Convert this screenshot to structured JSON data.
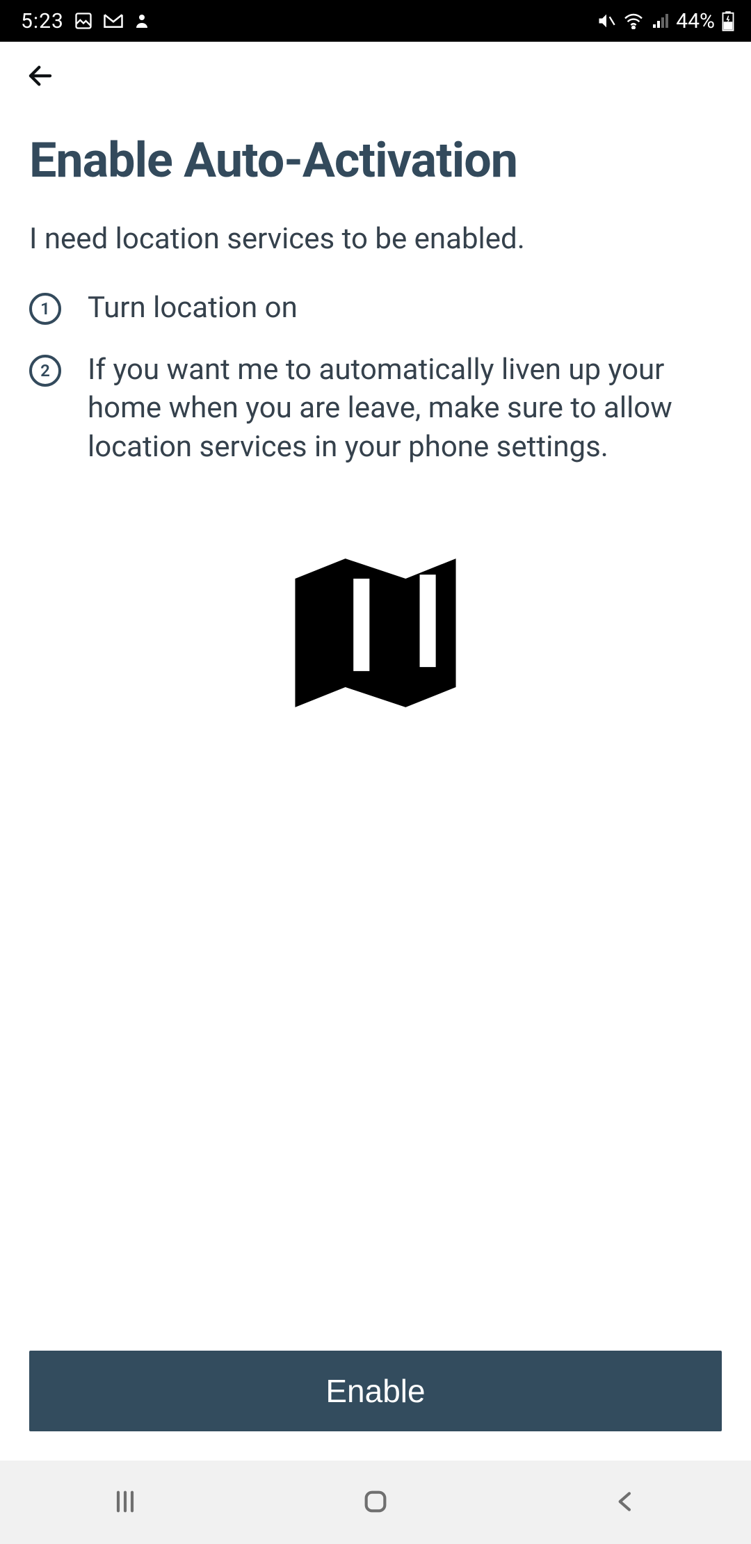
{
  "status": {
    "time": "5:23",
    "battery_pct": "44%",
    "icons_left": [
      "picture-icon",
      "gmail-icon",
      "person-icon"
    ],
    "icons_right": [
      "mute-icon",
      "wifi-icon",
      "signal-icon",
      "battery-icon"
    ]
  },
  "page": {
    "title": "Enable Auto-Activation",
    "subtitle": "I need location services to be enabled.",
    "steps": [
      {
        "num": "1",
        "text": "Turn location on"
      },
      {
        "num": "2",
        "text": "If you want me to automatically liven up your home when you are leave, make sure to allow location services in your phone settings."
      }
    ],
    "illustration": "map-icon",
    "primary_action": "Enable"
  },
  "nav": {
    "recent": "recent-apps",
    "home": "home",
    "back": "back"
  },
  "colors": {
    "heading": "#334a5c",
    "body": "#35414c",
    "button_bg": "#334c5e",
    "status_bg": "#000000",
    "nav_bg": "#f1f1f1"
  }
}
